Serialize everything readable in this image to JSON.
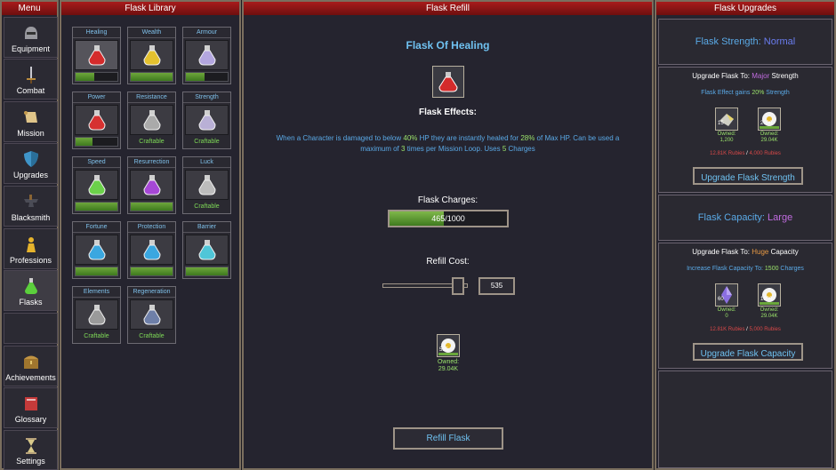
{
  "menu": {
    "title": "Menu",
    "items": [
      {
        "label": "Equipment",
        "icon": "helmet-icon"
      },
      {
        "label": "Combat",
        "icon": "sword-icon"
      },
      {
        "label": "Mission",
        "icon": "scroll-icon"
      },
      {
        "label": "Upgrades",
        "icon": "shield-icon"
      },
      {
        "label": "Blacksmith",
        "icon": "anvil-icon"
      },
      {
        "label": "Professions",
        "icon": "person-icon"
      },
      {
        "label": "Flasks",
        "icon": "flask-icon"
      },
      {
        "label": "Achievements",
        "icon": "chest-icon"
      },
      {
        "label": "Glossary",
        "icon": "book-icon"
      },
      {
        "label": "Settings",
        "icon": "hourglass-icon"
      }
    ]
  },
  "library": {
    "title": "Flask Library",
    "flasks": [
      {
        "name": "Healing",
        "color": "#d42b2b",
        "progress": 0.45,
        "status": ""
      },
      {
        "name": "Wealth",
        "color": "#e4c12e",
        "progress": 1.0,
        "status": ""
      },
      {
        "name": "Armour",
        "color": "#b3a6df",
        "progress": 0.45,
        "status": ""
      },
      {
        "name": "Power",
        "color": "#d63131",
        "progress": 0.4,
        "status": ""
      },
      {
        "name": "Resistance",
        "color": "#aaaaaa",
        "progress": null,
        "status": "Craftable"
      },
      {
        "name": "Strength",
        "color": "#b9b0d6",
        "progress": null,
        "status": "Craftable"
      },
      {
        "name": "Speed",
        "color": "#6bd14a",
        "progress": 1.0,
        "status": ""
      },
      {
        "name": "Resurrection",
        "color": "#a647d6",
        "progress": 1.0,
        "status": ""
      },
      {
        "name": "Luck",
        "color": "#bcbcbc",
        "progress": null,
        "status": "Craftable"
      },
      {
        "name": "Fortune",
        "color": "#3aa7e0",
        "progress": 1.0,
        "status": ""
      },
      {
        "name": "Protection",
        "color": "#3aa7e0",
        "progress": 1.0,
        "status": ""
      },
      {
        "name": "Barrier",
        "color": "#4fc6d8",
        "progress": 1.0,
        "status": ""
      },
      {
        "name": "Elements",
        "color": "#9a9a9a",
        "progress": null,
        "status": "Craftable"
      },
      {
        "name": "Regeneration",
        "color": "#6e7fa8",
        "progress": null,
        "status": "Craftable"
      }
    ]
  },
  "refill": {
    "title": "Flask Refill",
    "flask_name": "Flask Of Healing",
    "effects_label": "Flask Effects:",
    "effects_lines": [
      [
        "When a Character is damaged to below ",
        "40%",
        " HP they are instantly healed for ",
        "28%",
        " of Max HP. Can be used a"
      ],
      [
        "maximum of ",
        "3",
        " times per Mission Loop. Uses ",
        "5",
        " Charges"
      ]
    ],
    "charges_label": "Flask Charges:",
    "charges_text": "465/1000",
    "charges_fraction": 0.465,
    "cost_label": "Refill Cost:",
    "cost_value": "535",
    "slider_fraction": 0.95,
    "res_count": "535",
    "res_owned_label": "Owned:",
    "res_owned_value": "29.04K",
    "refill_button": "Refill Flask"
  },
  "upgrades": {
    "title": "Flask Upgrades",
    "strength": {
      "label": "Flask Strength: ",
      "value": "Normal",
      "upgrade_to_prefix": "Upgrade Flask To: ",
      "upgrade_to_tier": "Major",
      "upgrade_to_suffix": " Strength",
      "effect_prefix": "Flask Effect gains ",
      "effect_value": "20%",
      "effect_suffix": " Strength",
      "res1_count": "15",
      "res1_owned_label": "Owned:",
      "res1_owned": "1,200",
      "res2_count": "2000",
      "res2_owned_label": "Owned:",
      "res2_owned": "29.04K",
      "cost_text_a": "12.81K Rubies",
      "cost_sep": " / ",
      "cost_text_b": "4,000 Rubies",
      "button": "Upgrade Flask Strength"
    },
    "capacity": {
      "label": "Flask Capacity: ",
      "value": "Large",
      "upgrade_to_prefix": "Upgrade Flask To: ",
      "upgrade_to_tier": "Huge",
      "upgrade_to_suffix": " Capacity",
      "effect_prefix": "Increase Flask Capacity To: ",
      "effect_value": "1500",
      "effect_suffix": " Charges",
      "res1_count": "60",
      "res1_owned_label": "Owned:",
      "res1_owned": "0",
      "res2_count": "1800",
      "res2_owned_label": "Owned:",
      "res2_owned": "29.04K",
      "cost_text_a": "12.81K Rubies",
      "cost_sep": " / ",
      "cost_text_b": "5,000 Rubies",
      "button": "Upgrade Flask Capacity"
    }
  }
}
